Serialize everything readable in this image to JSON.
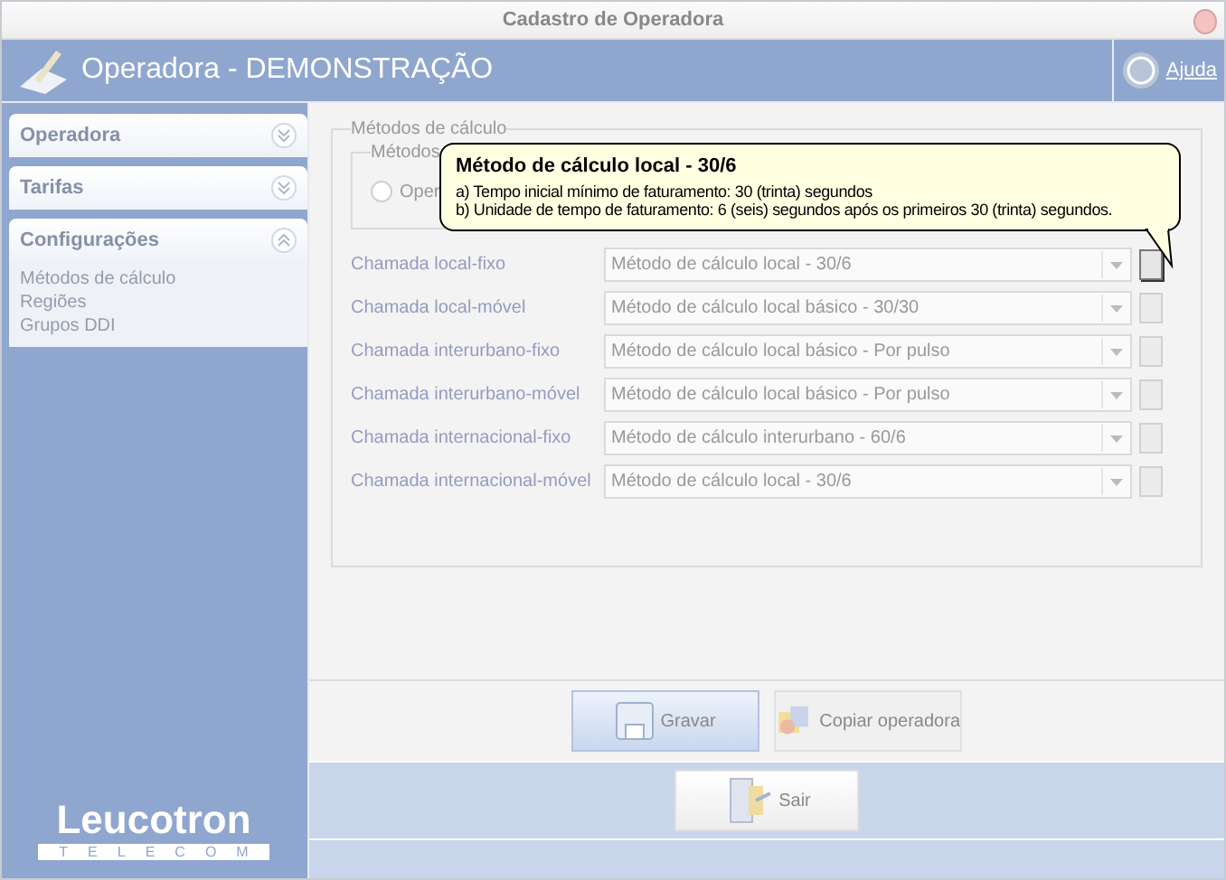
{
  "window": {
    "title": "Cadastro de Operadora"
  },
  "header": {
    "title": "Operadora - DEMONSTRAÇÃO",
    "help": "Ajuda"
  },
  "sidebar": {
    "sections": [
      {
        "label": "Operadora",
        "expanded": false
      },
      {
        "label": "Tarifas",
        "expanded": false
      },
      {
        "label": "Configurações",
        "expanded": true,
        "items": [
          "Métodos de cálculo",
          "Regiões",
          "Grupos DDI"
        ]
      }
    ],
    "logo": {
      "name": "Leucotron",
      "tagline": "TELECOM"
    }
  },
  "group": {
    "title": "Métodos de cálculo",
    "inner_title": "Métodos",
    "radio": {
      "label": "Oper",
      "selected": false
    },
    "rows": [
      {
        "label": "Chamada local-fixo",
        "value": "Método de cálculo local - 30/6",
        "highlighted": true
      },
      {
        "label": "Chamada local-móvel",
        "value": "Método de cálculo local básico - 30/30",
        "highlighted": false
      },
      {
        "label": "Chamada interurbano-fixo",
        "value": "Método de cálculo local básico - Por pulso",
        "highlighted": false
      },
      {
        "label": "Chamada interurbano-móvel",
        "value": "Método de cálculo local básico - Por pulso",
        "highlighted": false
      },
      {
        "label": "Chamada internacional-fixo",
        "value": "Método de cálculo interurbano - 60/6",
        "highlighted": false
      },
      {
        "label": "Chamada internacional-móvel",
        "value": "Método de cálculo local - 30/6",
        "highlighted": false
      }
    ]
  },
  "tooltip": {
    "title": "Método de cálculo local - 30/6",
    "lines": [
      "a) Tempo inicial mínimo de faturamento: 30 (trinta) segundos",
      "b) Unidade de tempo de faturamento: 6 (seis) segundos após os primeiros 30 (trinta) segundos."
    ]
  },
  "buttons": [
    {
      "label": "Gravar",
      "kind": "save"
    },
    {
      "label": "Copiar operadora",
      "kind": "copy"
    }
  ],
  "exit_button": {
    "label": "Sair"
  }
}
